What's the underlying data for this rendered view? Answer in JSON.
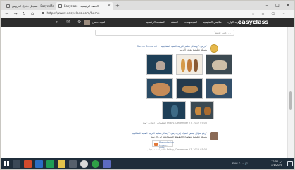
{
  "browser": {
    "tabs": [
      {
        "label": "تسجيل دخول الدروس | Easyclass"
      },
      {
        "label": "Easyclass - الحصة الرئيسية"
      }
    ],
    "new_tab_glyph": "+",
    "window_buttons": [
      "–",
      "□",
      "✕"
    ],
    "url": "https://www.easyclass.com/home",
    "nav_glyphs": {
      "back": "←",
      "forward": "→",
      "reload": "↻",
      "home": "⌂"
    }
  },
  "site": {
    "brand": "easyclass",
    "menu": [
      "الصفحة الرئيسية",
      "الصف",
      "المجموعات",
      "مكتبتي التعليمية",
      "البريد الوارد"
    ],
    "user_name": "لمياء حسن"
  },
  "feed": {
    "ask_placeholder": "اكتب تعليقاً ...",
    "post1": {
      "author": "Danah Samandi",
      "head": "Danah Samandi ← درس: \"وسائل تعليم التربية الفنية التشكيلية\"",
      "sub": "وسيلة تعليمية لمادة التربية",
      "meta": "التعليقات · إعجاب · منذ Friday, December 27, 2019 07:05"
    },
    "post2": {
      "head": "رفع سؤال ببعض المواد إلى درس: \"وسائل تعليم التربية الفنية التشكيلية\"",
      "sub": "وسيلة تعليمية لتوضيح الخطوط المستخدمة في الرسم",
      "attachment": "Presentation Lesso... pptx",
      "meta": "التعليقات · إعجاب · Friday, December 27, 2019 07:04"
    }
  },
  "taskbar": {
    "tray": "ENG  ⌃  ☁  🔊",
    "time": "12:51 ص",
    "date": "1/1/2020"
  }
}
